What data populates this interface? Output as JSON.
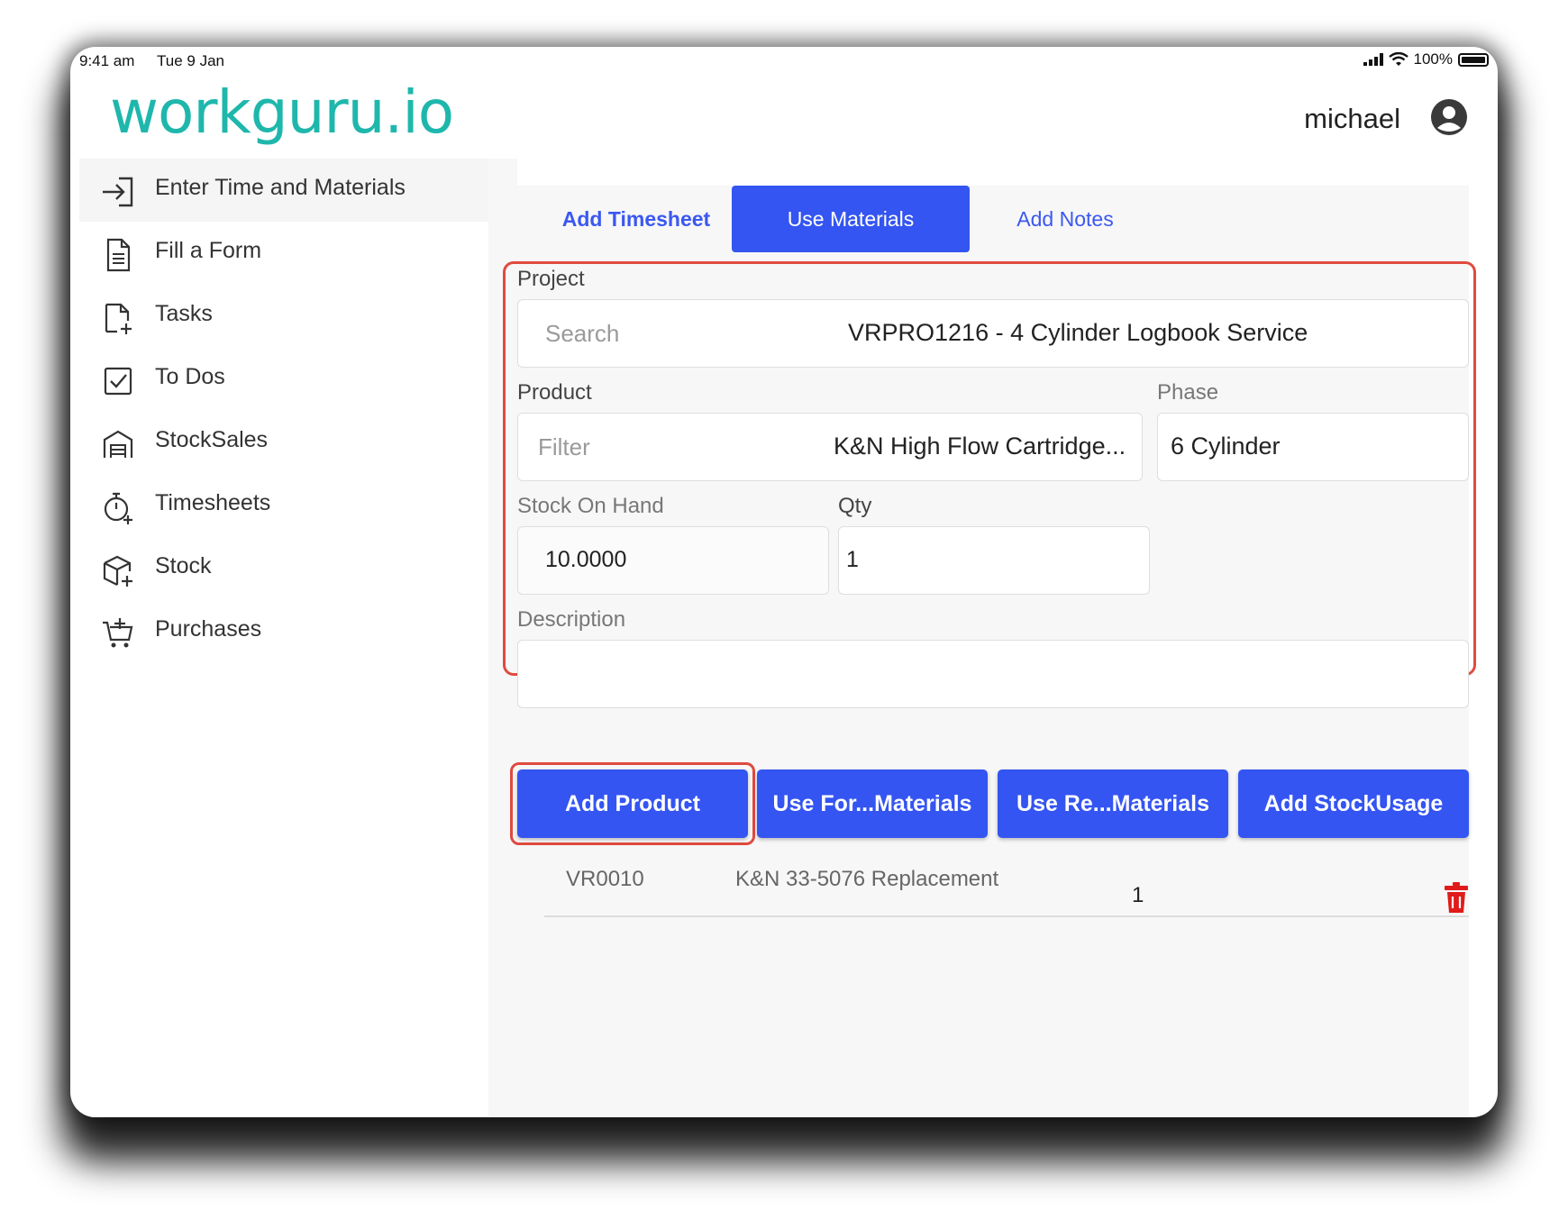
{
  "status_bar": {
    "time": "9:41 am",
    "date": "Tue 9 Jan",
    "battery": "100%"
  },
  "header": {
    "logo": "workguru.io",
    "username": "michael"
  },
  "sidebar": {
    "items": [
      {
        "label": "Enter Time and Materials",
        "icon": "sign-in-icon",
        "active": true
      },
      {
        "label": "Fill a Form",
        "icon": "document-icon"
      },
      {
        "label": "Tasks",
        "icon": "task-add-icon"
      },
      {
        "label": "To Dos",
        "icon": "checkbox-icon"
      },
      {
        "label": "StockSales",
        "icon": "warehouse-icon"
      },
      {
        "label": "Timesheets",
        "icon": "stopwatch-icon"
      },
      {
        "label": "Stock",
        "icon": "package-add-icon"
      },
      {
        "label": "Purchases",
        "icon": "cart-add-icon"
      }
    ]
  },
  "tabs": [
    {
      "label": "Add Timesheet"
    },
    {
      "label": "Use Materials",
      "active": true
    },
    {
      "label": "Add Notes"
    }
  ],
  "form": {
    "project_label": "Project",
    "project_placeholder": "Search",
    "project_value": "VRPRO1216 - 4 Cylinder Logbook Service",
    "product_label": "Product",
    "product_placeholder": "Filter",
    "product_value": "K&N High Flow Cartridge...",
    "phase_label": "Phase",
    "phase_value": "6 Cylinder",
    "stock_label": "Stock On Hand",
    "stock_value": "10.0000",
    "qty_label": "Qty",
    "qty_value": "1",
    "description_label": "Description",
    "description_value": ""
  },
  "buttons": {
    "add_product": "Add Product",
    "use_for_materials": "Use For...Materials",
    "use_re_materials": "Use Re...Materials",
    "add_stock_usage": "Add StockUsage"
  },
  "materials": [
    {
      "code": "VR0010",
      "description": "K&N 33-5076 Replacement",
      "qty": "1"
    }
  ],
  "colors": {
    "brand": "#1fb7ac",
    "accent": "#3455f2",
    "highlight": "#e04a3f",
    "delete": "#e01b1b"
  }
}
